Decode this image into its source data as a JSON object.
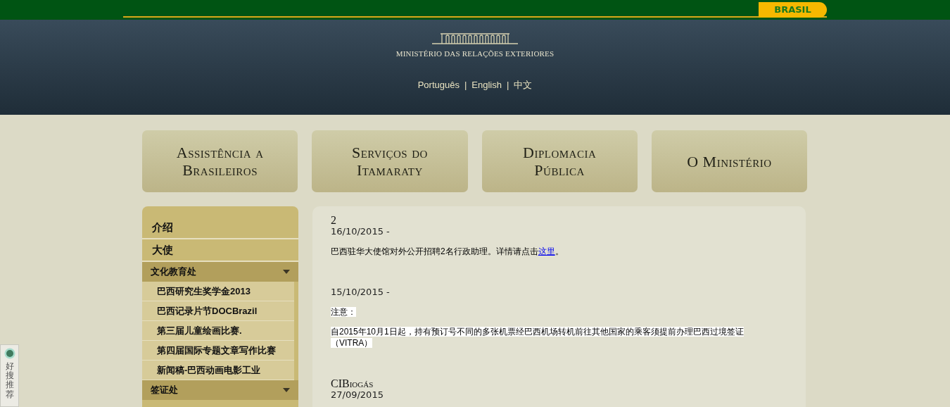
{
  "top_bar": {
    "badge": "BRASIL"
  },
  "header": {
    "title": "MINISTÉRIO DAS RELAÇÕES EXTERIORES",
    "languages": [
      {
        "label": "Português"
      },
      {
        "label": "English"
      },
      {
        "label": "中文"
      }
    ],
    "separator": "|"
  },
  "nav": [
    {
      "label": "Assistência a Brasileiros"
    },
    {
      "label": "Serviços do Itamaraty"
    },
    {
      "label": "Diplomacia Pública"
    },
    {
      "label": "O Ministério"
    }
  ],
  "sidebar": {
    "items": [
      {
        "kind": "item",
        "label": "介绍"
      },
      {
        "kind": "item",
        "label": "大使"
      },
      {
        "kind": "section",
        "label": "文化教育处",
        "children": [
          {
            "label": "巴西研究生奖学金2013"
          },
          {
            "label": "巴西记录片节DOCBrazil"
          },
          {
            "label": "第三届儿童绘画比赛."
          },
          {
            "label": "第四届国际专题文章写作比赛"
          },
          {
            "label": "新闻稿-巴西动画电影工业"
          }
        ]
      },
      {
        "kind": "section",
        "label": "签证处"
      }
    ]
  },
  "side_widget": {
    "label": "好搜推荐"
  },
  "news": [
    {
      "title": "2",
      "date": "16/10/2015 -",
      "paragraphs": [
        {
          "text": "巴西驻华大使馆对外公开招聘2名行政助理。详情请点击",
          "link": "这里",
          "after": "。",
          "highlighted": false
        }
      ]
    },
    {
      "date": "15/10/2015 -",
      "paragraphs": [
        {
          "text": "注意：",
          "highlighted": true
        },
        {
          "text": "自2015年10月1日起，持有预订号不同的多张机票经巴西机场转机前往其他国家的乘客须提前办理巴西过境签证（VITRA）",
          "highlighted": true
        }
      ]
    },
    {
      "title": "CIBiogás",
      "date": "27/09/2015"
    }
  ]
}
